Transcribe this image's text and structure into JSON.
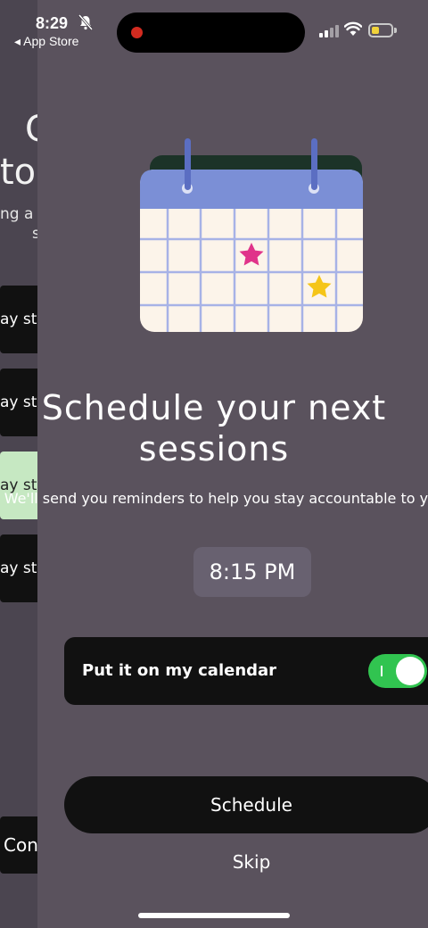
{
  "status_bar": {
    "time": "8:29",
    "back_label": "◂ App Store"
  },
  "background_page": {
    "title_line1": "C",
    "title_line2": "to",
    "subtitle_line1": "ng a",
    "subtitle_line2": "s",
    "cards": [
      {
        "label": "ay stre"
      },
      {
        "label": "ay stre"
      },
      {
        "label": "ay stre"
      },
      {
        "label": "ay stre"
      }
    ],
    "bottom_button": "Con"
  },
  "sheet": {
    "title": "Schedule your next sessions",
    "subtitle": "We'll send you reminders to help you stay accountable to your goals.",
    "time_value": "8:15 PM",
    "calendar_toggle": {
      "label": "Put it on my calendar",
      "on": true
    },
    "schedule_label": "Schedule",
    "skip_label": "Skip"
  },
  "colors": {
    "sheet_bg": "#5a525d",
    "dark_button": "#111111",
    "toggle_on": "#31c450",
    "calendar_header": "#7b8fd6",
    "star_pink": "#e0338a",
    "star_yellow": "#f5c518"
  }
}
